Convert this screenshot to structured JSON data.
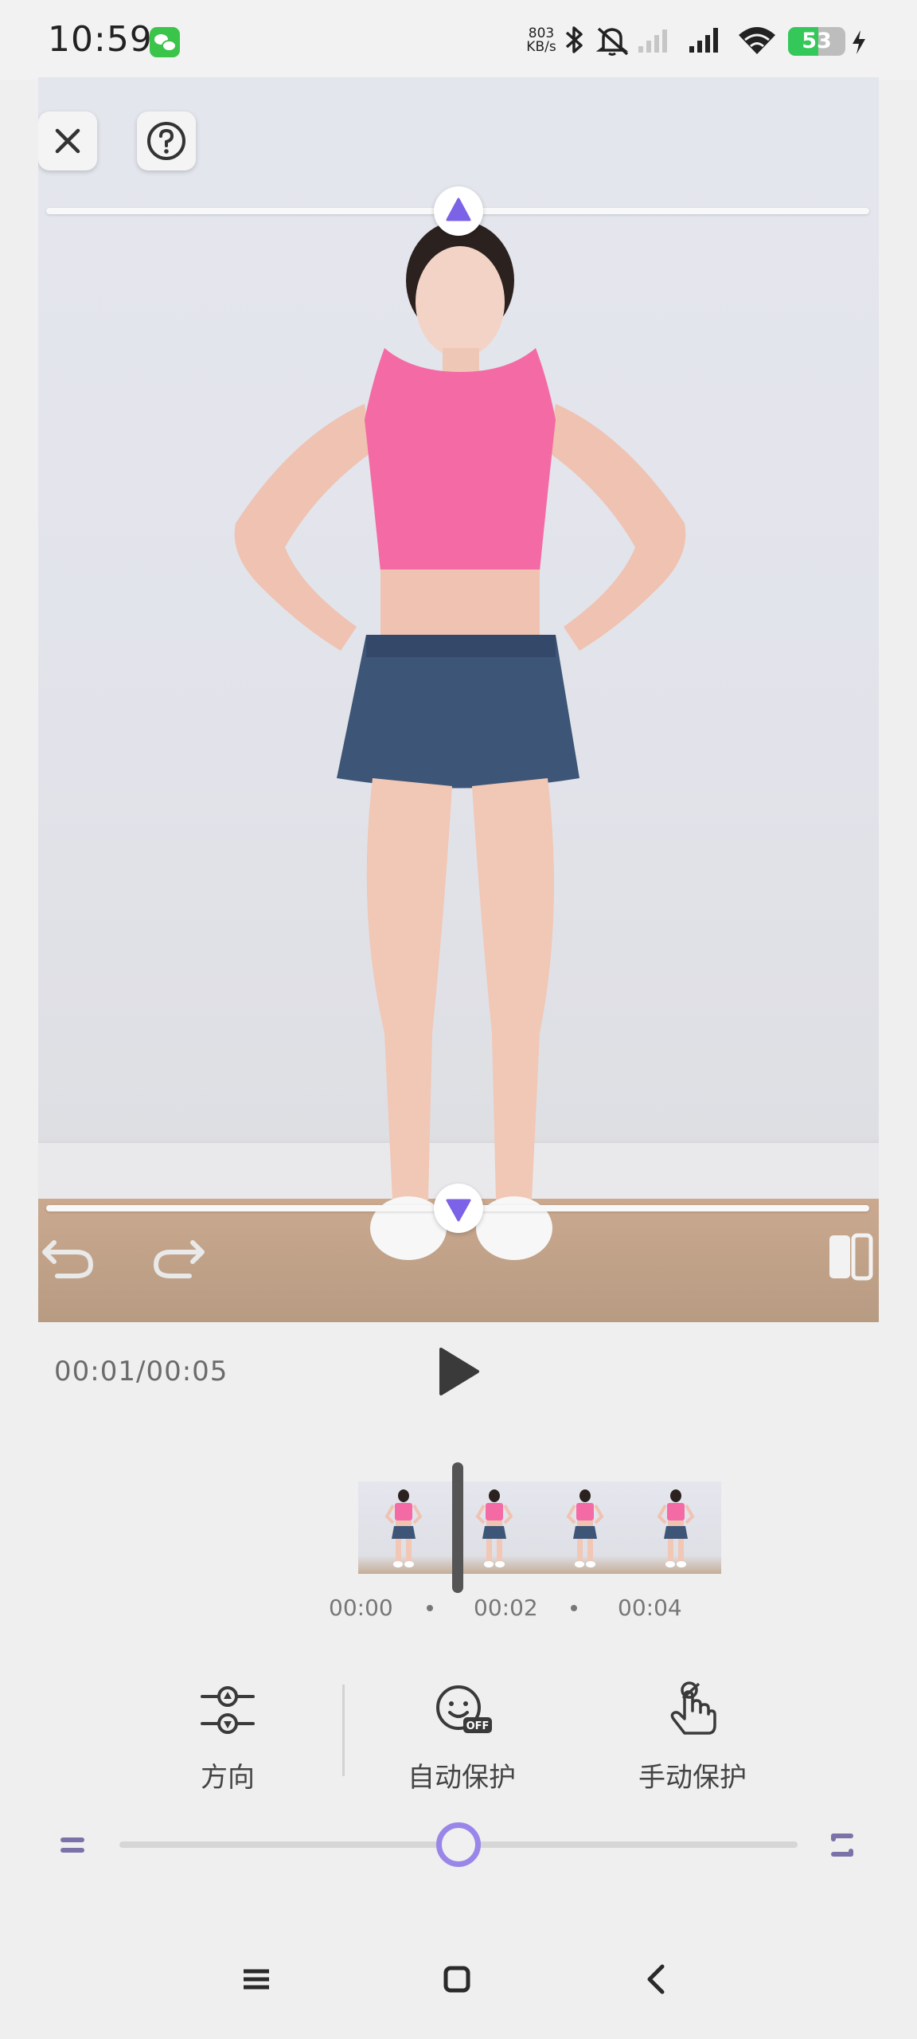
{
  "status_bar": {
    "time": "10:59",
    "net_speed_value": "803",
    "net_speed_unit": "KB/s",
    "battery_level": "53",
    "icons": [
      "wechat-icon",
      "bluetooth-icon",
      "mute-icon",
      "signal-weak-icon",
      "signal-icon",
      "wifi-icon",
      "battery-icon",
      "charging-icon"
    ]
  },
  "editor": {
    "top_handle_direction": "up",
    "bottom_handle_direction": "down",
    "accent_color": "#7b62e6"
  },
  "playback": {
    "timecode": "00:01/00:05",
    "progress": 0.2
  },
  "timeline": {
    "thumbnail_count": 4,
    "tick_labels": [
      "00:00",
      "00:02",
      "00:04"
    ]
  },
  "tools": {
    "direction_label": "方向",
    "auto_protect_label": "自动保护",
    "manual_protect_label": "手动保护"
  },
  "slider": {
    "value": 0.5
  }
}
